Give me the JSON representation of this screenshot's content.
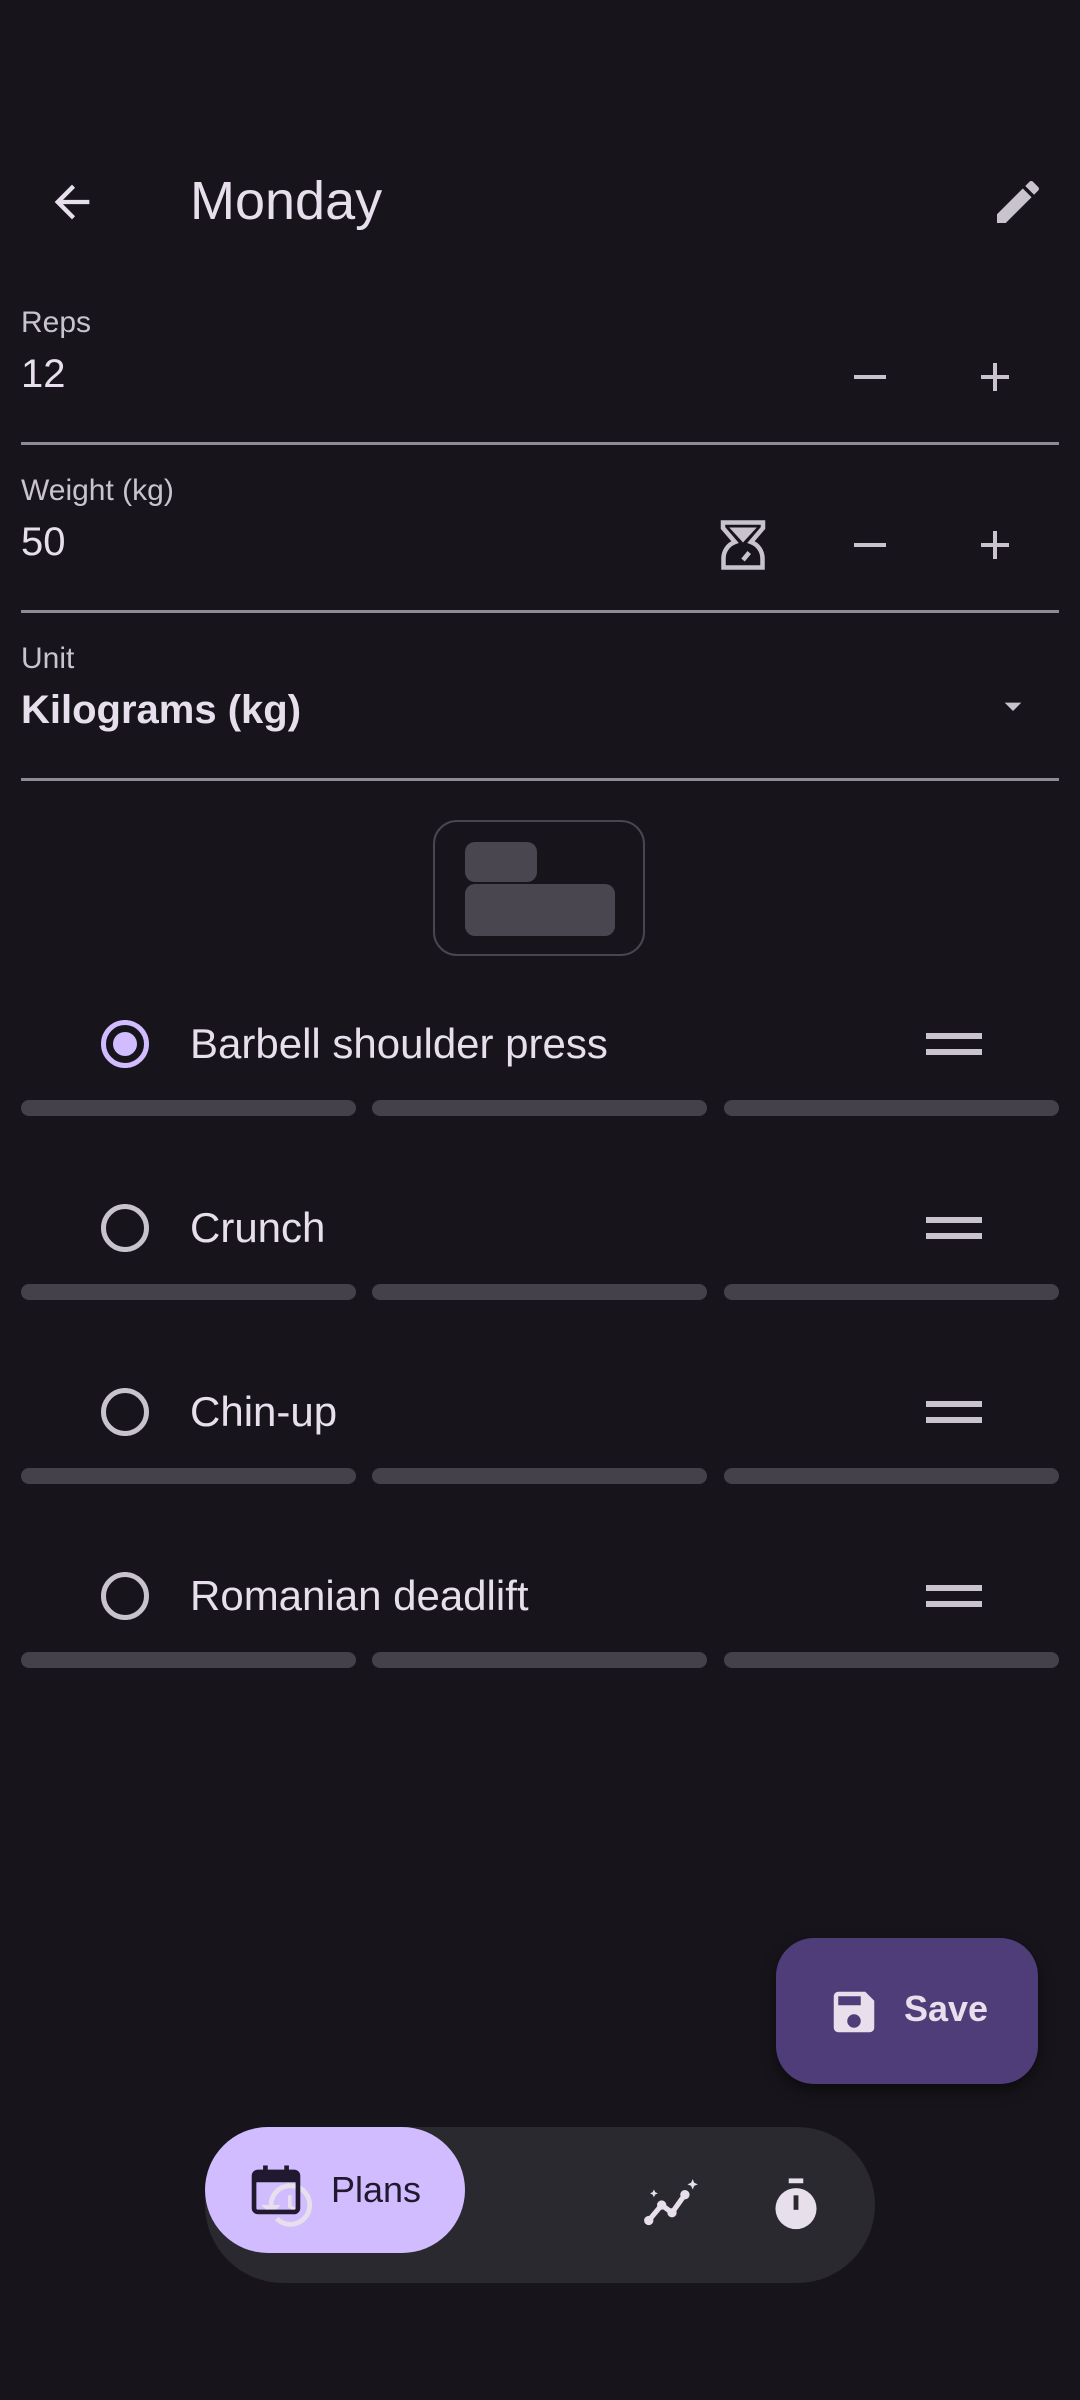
{
  "app_bar": {
    "title": "Monday"
  },
  "fields": {
    "reps": {
      "label": "Reps",
      "value": "12"
    },
    "weight": {
      "label": "Weight (kg)",
      "value": "50"
    },
    "unit": {
      "label": "Unit",
      "value": "Kilograms (kg)"
    }
  },
  "exercises": [
    {
      "name": "Barbell shoulder press",
      "selected": true
    },
    {
      "name": "Crunch",
      "selected": false
    },
    {
      "name": "Chin-up",
      "selected": false
    },
    {
      "name": "Romanian deadlift",
      "selected": false
    }
  ],
  "fab": {
    "label": "Save"
  },
  "nav": {
    "plans_label": "Plans",
    "active": "Plans"
  },
  "colors": {
    "background": "#17151b",
    "accent": "#d0bcff",
    "fab": "#4f3d7a",
    "nav_bg": "#2b2930"
  }
}
